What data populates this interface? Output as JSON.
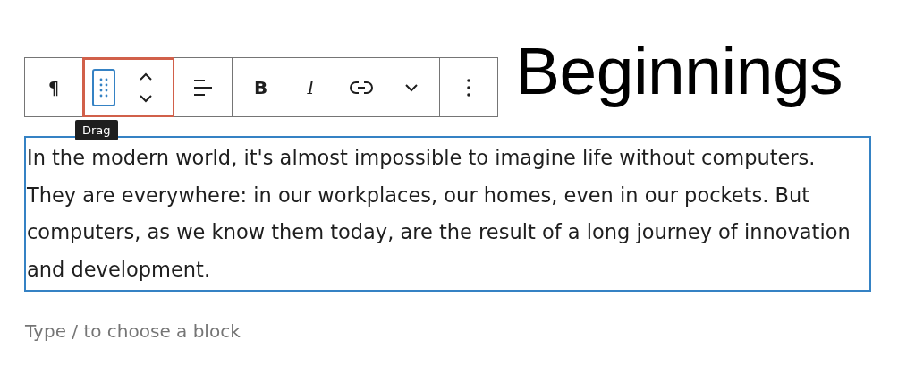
{
  "heading": {
    "text": "Beginnings"
  },
  "toolbar": {
    "groups": [
      {
        "highlighted": false,
        "buttons": [
          {
            "kind": "paragraph",
            "label": "¶",
            "focused": false
          }
        ]
      },
      {
        "highlighted": true,
        "buttons": [
          {
            "kind": "drag",
            "focused": true
          },
          {
            "kind": "movers",
            "focused": false
          }
        ]
      },
      {
        "highlighted": false,
        "buttons": [
          {
            "kind": "align",
            "focused": false
          }
        ]
      },
      {
        "highlighted": false,
        "buttons": [
          {
            "kind": "bold",
            "label": "B",
            "focused": false
          },
          {
            "kind": "italic",
            "label": "I",
            "focused": false
          },
          {
            "kind": "link",
            "focused": false
          },
          {
            "kind": "more-formats",
            "focused": false
          }
        ]
      },
      {
        "highlighted": false,
        "buttons": [
          {
            "kind": "options",
            "focused": false
          }
        ]
      }
    ]
  },
  "tooltip": {
    "text": "Drag"
  },
  "paragraph": {
    "text": "In the modern world, it's almost impossible to imagine life without computers. They are everywhere: in our workplaces, our homes, even in our pockets. But computers, as we know them today, are the result of a long journey of innovation and development.",
    "selected": true
  },
  "placeholder": "Type / to choose a block"
}
